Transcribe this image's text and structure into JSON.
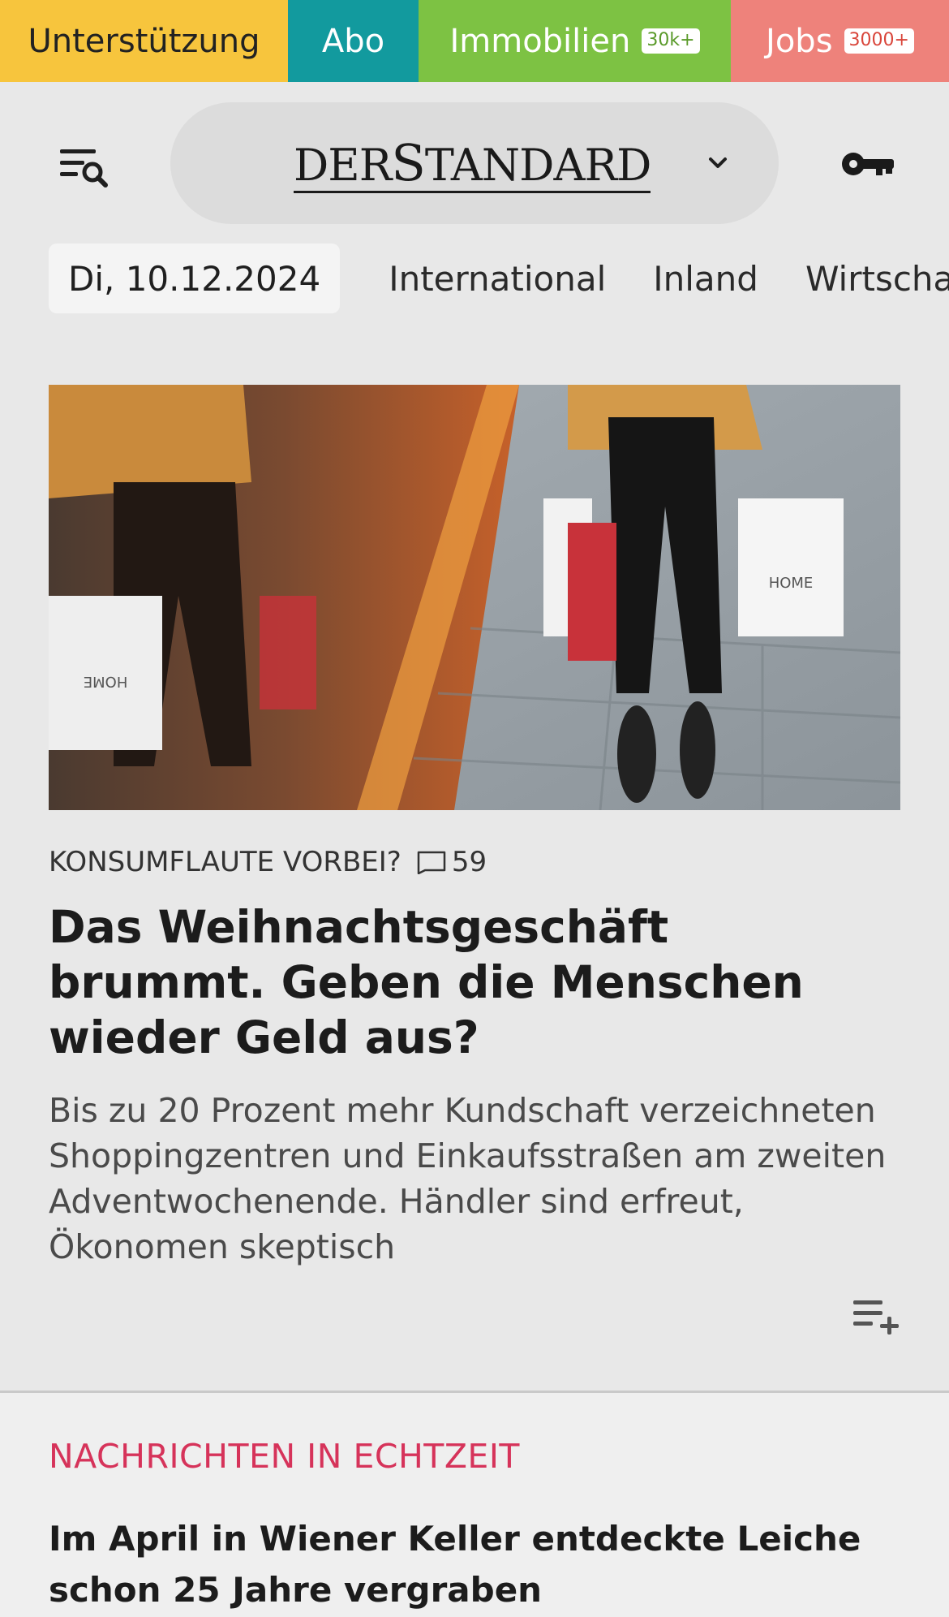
{
  "topbar": {
    "support": "Unterstützung",
    "abo": "Abo",
    "immobilien": "Immobilien",
    "immobilien_badge": "30k+",
    "jobs": "Jobs",
    "jobs_badge": "3000+"
  },
  "header": {
    "logo_part1": "DER",
    "logo_part2": "S",
    "logo_part3": "TANDARD"
  },
  "nav": {
    "date": "Di, 10.12.2024",
    "tabs": [
      "International",
      "Inland",
      "Wirtscha"
    ]
  },
  "article": {
    "kicker": "KONSUMFLAUTE VORBEI?",
    "comment_count": "59",
    "headline": "Das Weihnachtsgeschäft brummt. Geben die Menschen wieder Geld aus?",
    "teaser": "Bis zu 20 Prozent mehr Kundschaft verzeichneten Shoppingzentren und Einkaufsstraßen am zweiten Adventwochenende. Händler sind erfreut, Ökonomen skeptisch"
  },
  "live": {
    "section_title": "NACHRICHTEN IN ECHTZEIT",
    "headline": "Im April in Wiener Keller entdeckte Leiche schon 25 Jahre vergraben"
  },
  "colors": {
    "support": "#f7c53d",
    "abo": "#129a9e",
    "immobilien": "#7dc243",
    "jobs": "#ee827b",
    "live_accent": "#d6335a"
  },
  "icons": [
    "menu-search-icon",
    "chevron-down-icon",
    "key-icon",
    "comment-icon",
    "add-to-list-icon"
  ]
}
